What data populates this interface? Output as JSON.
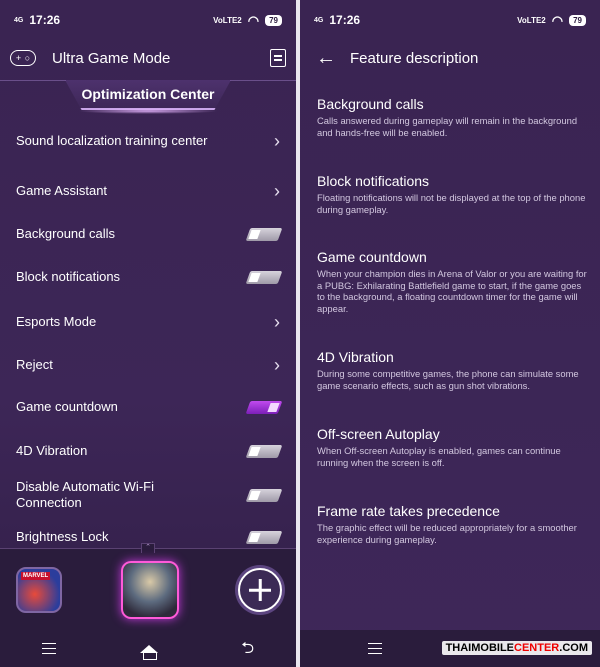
{
  "status": {
    "time": "17:26",
    "signal": "4G",
    "volte": "VoLTE2",
    "battery": "79"
  },
  "left_panel": {
    "header_title": "Ultra Game Mode",
    "section_title": "Optimization Center",
    "items": [
      {
        "label": "Sound localization training center",
        "control": "chevron"
      },
      {
        "label": "Game Assistant",
        "control": "chevron"
      },
      {
        "label": "Background calls",
        "control": "toggle",
        "on": false
      },
      {
        "label": "Block notifications",
        "control": "toggle",
        "on": false
      },
      {
        "label": "Esports Mode",
        "control": "chevron"
      },
      {
        "label": "Reject",
        "control": "chevron"
      },
      {
        "label": "Game countdown",
        "control": "toggle",
        "on": true
      },
      {
        "label": "4D Vibration",
        "control": "toggle",
        "on": false
      },
      {
        "label": "Disable Automatic Wi-Fi Connection",
        "control": "toggle",
        "on": false
      },
      {
        "label": "Brightness Lock",
        "control": "toggle",
        "on": false
      }
    ],
    "dock": {
      "apps": [
        {
          "icon": "marvel-game-icon",
          "tag": "MARVEL"
        },
        {
          "icon": "pubg-game-icon"
        }
      ],
      "add_icon": "plus-icon"
    }
  },
  "right_panel": {
    "header_title": "Feature description",
    "features": [
      {
        "title": "Background calls",
        "desc": "Calls answered during gameplay will remain in the background and hands-free will be enabled."
      },
      {
        "title": "Block notifications",
        "desc": "Floating notifications will not be displayed at the top of the phone during gameplay."
      },
      {
        "title": "Game countdown",
        "desc": "When your champion dies in Arena of Valor or you are waiting for a PUBG: Exhilarating Battlefield game to start, if the game goes to the background, a floating countdown timer for the game will appear."
      },
      {
        "title": "4D Vibration",
        "desc": "During some competitive games, the phone can simulate some game scenario effects, such as gun shot vibrations."
      },
      {
        "title": "Off-screen Autoplay",
        "desc": "When Off-screen Autoplay is enabled, games can continue running when the screen is off."
      },
      {
        "title": "Frame rate takes precedence",
        "desc": "The graphic effect will be reduced appropriately for a smoother experience during gameplay."
      }
    ]
  },
  "watermark": {
    "prefix": "THAIMOBILE",
    "highlight": "CENTER",
    "suffix": ".COM"
  }
}
